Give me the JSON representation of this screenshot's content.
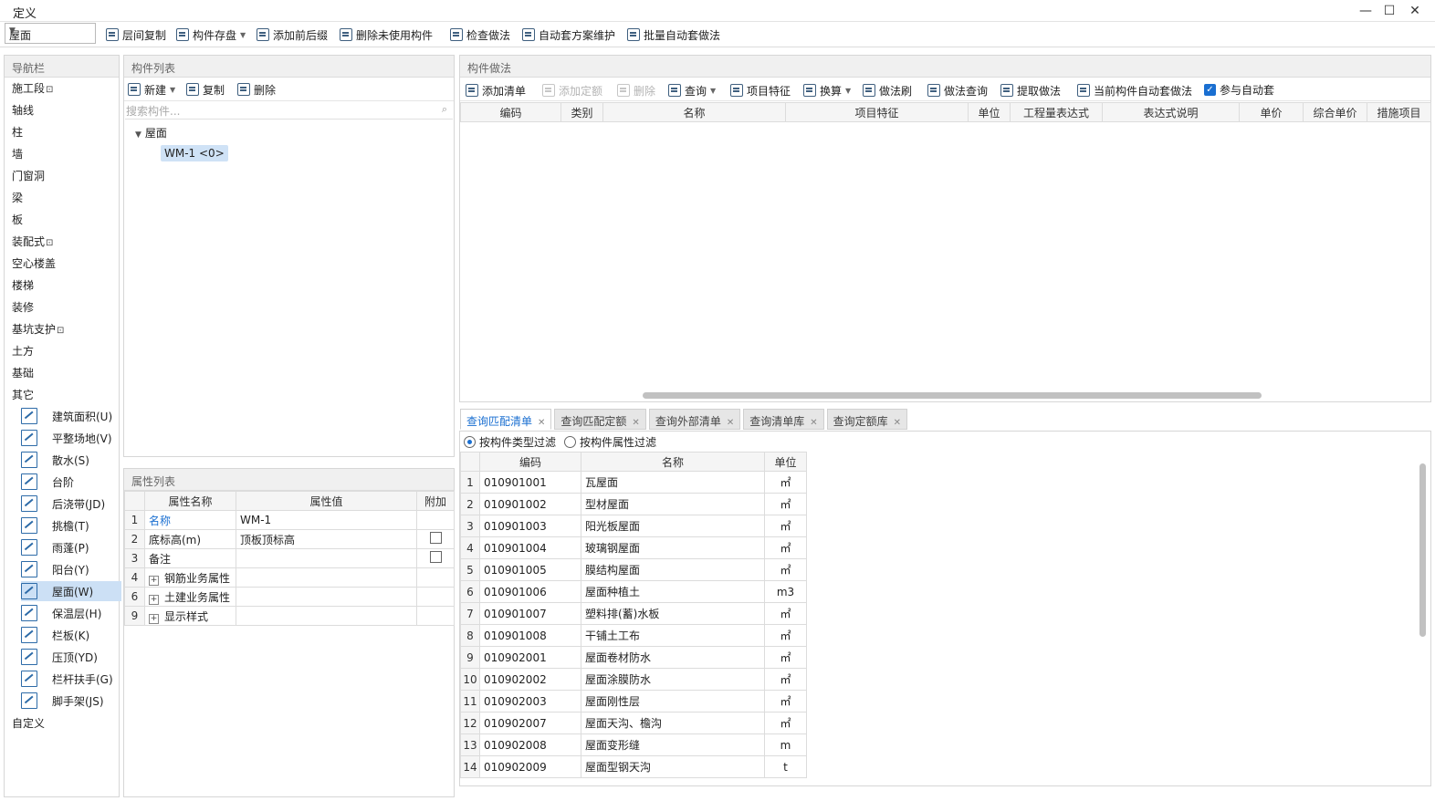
{
  "window": {
    "title": "定义"
  },
  "toolbar": {
    "combo_value": "屋面",
    "buttons": [
      "层间复制",
      "构件存盘",
      "添加前后缀",
      "删除未使用构件",
      "检查做法",
      "自动套方案维护",
      "批量自动套做法"
    ]
  },
  "nav": {
    "header": "导航栏",
    "items": [
      "施工段",
      "轴线",
      "柱",
      "墙",
      "门窗洞",
      "梁",
      "板",
      "装配式",
      "空心楼盖",
      "楼梯",
      "装修",
      "基坑支护",
      "土方",
      "基础",
      "其它"
    ],
    "sub_items": [
      "建筑面积(U)",
      "平整场地(V)",
      "散水(S)",
      "台阶",
      "后浇带(JD)",
      "挑檐(T)",
      "雨蓬(P)",
      "阳台(Y)",
      "屋面(W)",
      "保温层(H)",
      "栏板(K)",
      "压顶(YD)",
      "栏杆扶手(G)",
      "脚手架(JS)"
    ],
    "custom": "自定义",
    "lock_icon": "lock-icon"
  },
  "component_list": {
    "header": "构件列表",
    "new_label": "新建",
    "copy_label": "复制",
    "delete_label": "删除",
    "search_placeholder": "搜索构件...",
    "tree_root": "屋面",
    "tree_leaf": "WM-1 <0>"
  },
  "property_list": {
    "header": "属性列表",
    "columns": [
      "属性名称",
      "属性值",
      "附加"
    ],
    "rows": [
      {
        "num": "1",
        "name": "名称",
        "value": "WM-1"
      },
      {
        "num": "2",
        "name": "底标高(m)",
        "value": "顶板顶标高"
      },
      {
        "num": "3",
        "name": "备注",
        "value": ""
      },
      {
        "num": "4",
        "name": "钢筋业务属性",
        "value": ""
      },
      {
        "num": "6",
        "name": "土建业务属性",
        "value": ""
      },
      {
        "num": "9",
        "name": "显示样式",
        "value": ""
      }
    ]
  },
  "method_panel": {
    "header": "构件做法",
    "buttons": [
      "添加清单",
      "添加定额",
      "删除",
      "查询",
      "项目特征",
      "换算",
      "做法刷",
      "做法查询",
      "提取做法",
      "当前构件自动套做法"
    ],
    "checkbox_label": "参与自动套",
    "columns": [
      "编码",
      "类别",
      "名称",
      "项目特征",
      "单位",
      "工程量表达式",
      "表达式说明",
      "单价",
      "综合单价",
      "措施项目"
    ]
  },
  "query": {
    "tabs": [
      "查询匹配清单",
      "查询匹配定额",
      "查询外部清单",
      "查询清单库",
      "查询定额库"
    ],
    "filter_type": "按构件类型过滤",
    "filter_attr": "按构件属性过滤",
    "columns": [
      "编码",
      "名称",
      "单位"
    ],
    "rows": [
      {
        "num": "1",
        "code": "010901001",
        "name": "瓦屋面",
        "unit": "㎡"
      },
      {
        "num": "2",
        "code": "010901002",
        "name": "型材屋面",
        "unit": "㎡"
      },
      {
        "num": "3",
        "code": "010901003",
        "name": "阳光板屋面",
        "unit": "㎡"
      },
      {
        "num": "4",
        "code": "010901004",
        "name": "玻璃钢屋面",
        "unit": "㎡"
      },
      {
        "num": "5",
        "code": "010901005",
        "name": "膜结构屋面",
        "unit": "㎡"
      },
      {
        "num": "6",
        "code": "010901006",
        "name": "屋面种植土",
        "unit": "m3"
      },
      {
        "num": "7",
        "code": "010901007",
        "name": "塑料排(蓄)水板",
        "unit": "㎡"
      },
      {
        "num": "8",
        "code": "010901008",
        "name": "干铺土工布",
        "unit": "㎡"
      },
      {
        "num": "9",
        "code": "010902001",
        "name": "屋面卷材防水",
        "unit": "㎡"
      },
      {
        "num": "10",
        "code": "010902002",
        "name": "屋面涂膜防水",
        "unit": "㎡"
      },
      {
        "num": "11",
        "code": "010902003",
        "name": "屋面刚性层",
        "unit": "㎡"
      },
      {
        "num": "12",
        "code": "010902007",
        "name": "屋面天沟、檐沟",
        "unit": "㎡"
      },
      {
        "num": "13",
        "code": "010902008",
        "name": "屋面变形缝",
        "unit": "m"
      },
      {
        "num": "14",
        "code": "010902009",
        "name": "屋面型钢天沟",
        "unit": "t"
      }
    ]
  }
}
